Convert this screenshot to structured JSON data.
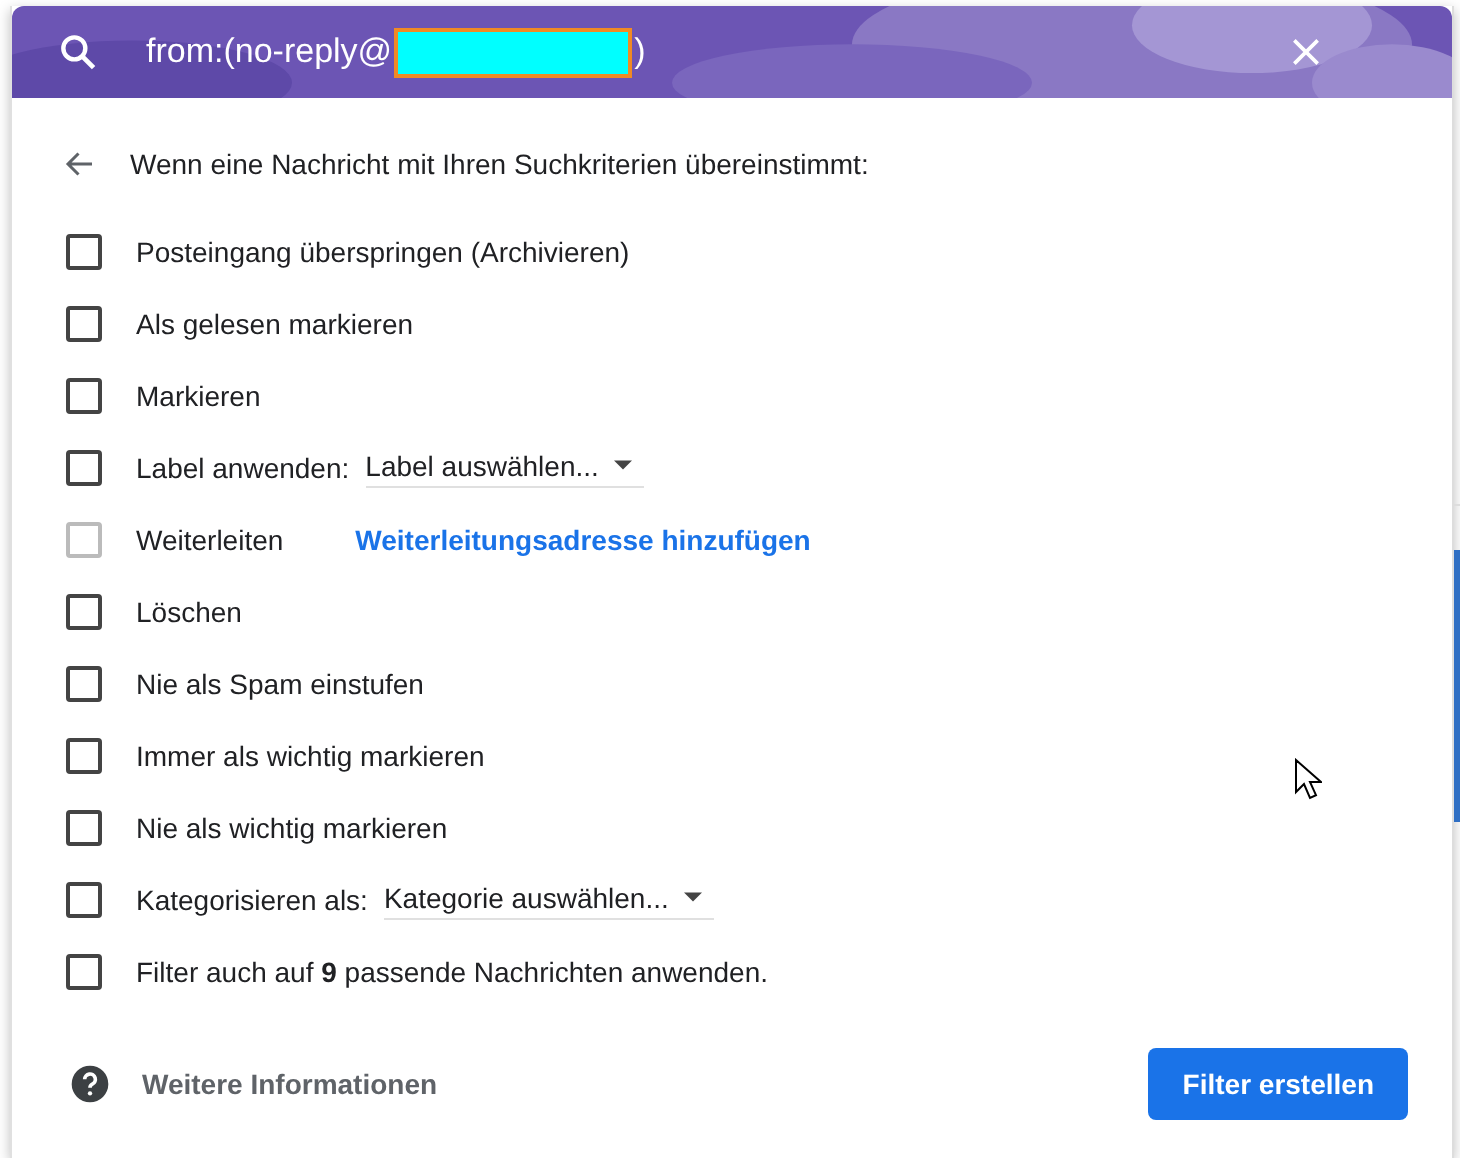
{
  "search": {
    "query_prefix": "from:(no-reply@",
    "redacted": true,
    "query_suffix": ")"
  },
  "heading": "Wenn eine Nachricht mit Ihren Suchkriterien übereinstimmt:",
  "options": [
    {
      "kind": "plain",
      "label": "Posteingang überspringen (Archivieren)",
      "checked": false,
      "disabled": false
    },
    {
      "kind": "plain",
      "label": "Als gelesen markieren",
      "checked": false,
      "disabled": false
    },
    {
      "kind": "plain",
      "label": "Markieren",
      "checked": false,
      "disabled": false
    },
    {
      "kind": "dropdown",
      "label": "Label anwenden:",
      "value": "Label auswählen...",
      "checked": false,
      "disabled": false
    },
    {
      "kind": "link",
      "label": "Weiterleiten",
      "link": "Weiterleitungsadresse hinzufügen",
      "checked": false,
      "disabled": true
    },
    {
      "kind": "plain",
      "label": "Löschen",
      "checked": false,
      "disabled": false
    },
    {
      "kind": "plain",
      "label": "Nie als Spam einstufen",
      "checked": false,
      "disabled": false
    },
    {
      "kind": "plain",
      "label": "Immer als wichtig markieren",
      "checked": false,
      "disabled": false
    },
    {
      "kind": "plain",
      "label": "Nie als wichtig markieren",
      "checked": false,
      "disabled": false
    },
    {
      "kind": "dropdown",
      "label": "Kategorisieren als:",
      "value": "Kategorie auswählen...",
      "checked": false,
      "disabled": false
    },
    {
      "kind": "plain",
      "label": "Filter auch auf **9** passende Nachrichten anwenden.",
      "checked": false,
      "disabled": false
    }
  ],
  "footer": {
    "help_link": "Weitere Informationen",
    "button": "Filter erstellen"
  }
}
